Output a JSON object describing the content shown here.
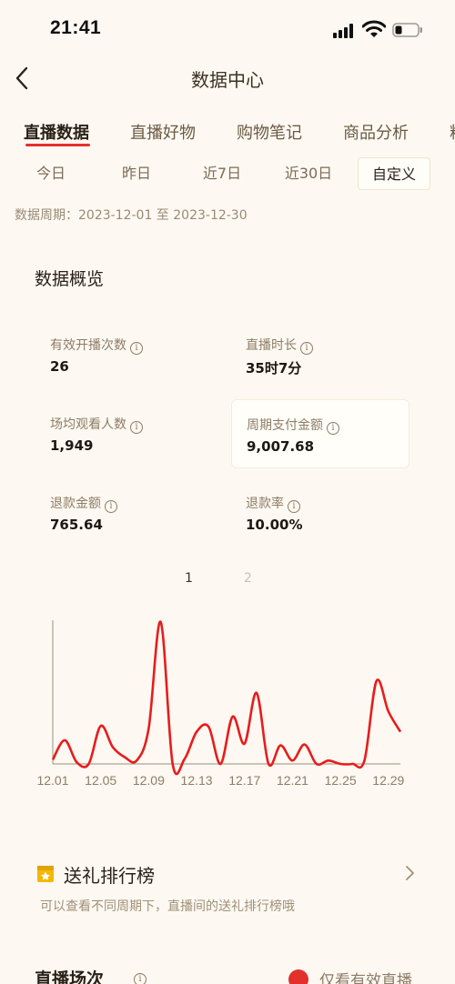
{
  "status_bar": {
    "time": "21:41"
  },
  "nav": {
    "title": "数据中心"
  },
  "tabs": [
    {
      "label": "直播数据"
    },
    {
      "label": "直播好物"
    },
    {
      "label": "购物笔记"
    },
    {
      "label": "商品分析"
    },
    {
      "label": "粉"
    }
  ],
  "date_filters": [
    {
      "label": "今日"
    },
    {
      "label": "昨日"
    },
    {
      "label": "近7日"
    },
    {
      "label": "近30日"
    },
    {
      "label": "自定义"
    }
  ],
  "period": "数据周期：2023-12-01 至 2023-12-30",
  "overview": {
    "title": "数据概览",
    "metrics": [
      {
        "label": "有效开播次数",
        "value": "26"
      },
      {
        "label": "直播时长",
        "value": "35时7分"
      },
      {
        "label": "场均观看人数",
        "value": "1,949"
      },
      {
        "label": "周期支付金额",
        "value": "9,007.68"
      },
      {
        "label": "退款金额",
        "value": "765.64"
      },
      {
        "label": "退款率",
        "value": "10.00%"
      }
    ],
    "pages": [
      "1",
      "2"
    ]
  },
  "chart_data": {
    "type": "line",
    "x_tick_labels": [
      "12.01",
      "12.05",
      "12.09",
      "12.13",
      "12.17",
      "12.21",
      "12.25",
      "12.29"
    ],
    "x": [
      1,
      2,
      3,
      4,
      5,
      6,
      7,
      8,
      9,
      10,
      11,
      12,
      13,
      14,
      15,
      16,
      17,
      18,
      19,
      20,
      21,
      22,
      23,
      24,
      25,
      26,
      27,
      28,
      29,
      30
    ],
    "series": [
      {
        "values": [
          5,
          28,
          2,
          0,
          45,
          20,
          8,
          4,
          42,
          168,
          0,
          6,
          38,
          44,
          0,
          56,
          24,
          84,
          0,
          22,
          4,
          23,
          0,
          4,
          0,
          0,
          4,
          98,
          62,
          38
        ]
      }
    ],
    "colors": {
      "line": "#e81c1c",
      "axis": "#9a8e7c"
    },
    "grid": false
  },
  "gift": {
    "title": "送礼排行榜",
    "subtitle": "可以查看不同周期下，直播间的送礼排行榜哦"
  },
  "session": {
    "title": "直播场次",
    "valid_label": "仅看有效直播"
  }
}
